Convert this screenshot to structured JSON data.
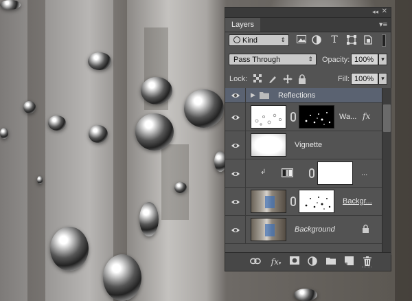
{
  "panel": {
    "tab_label": "Layers",
    "collapse_glyph": "◂◂",
    "close_glyph": "✕",
    "menu_glyph": "▾≡"
  },
  "filter": {
    "kind_label": "Kind",
    "kind_icon": "search-icon",
    "filter_icons": [
      "image-filter-icon",
      "adjustment-filter-icon",
      "type-filter-icon",
      "shape-filter-icon",
      "smart-object-filter-icon"
    ]
  },
  "blend": {
    "mode": "Pass Through",
    "opacity_label": "Opacity:",
    "opacity_value": "100%"
  },
  "lock": {
    "label": "Lock:",
    "fill_label": "Fill:",
    "fill_value": "100%",
    "icons": [
      "lock-transparent-icon",
      "lock-image-icon",
      "lock-position-icon",
      "lock-all-icon"
    ]
  },
  "layers": [
    {
      "name": "Reflections",
      "type": "group",
      "selected": true
    },
    {
      "name": "Wa...",
      "type": "smart-masked",
      "has_fx": true,
      "fx_label": "fx"
    },
    {
      "name": "Vignette",
      "type": "fill"
    },
    {
      "name": "...",
      "type": "adjustment-clipped"
    },
    {
      "name": "Backgr...",
      "type": "photo-masked"
    },
    {
      "name": "Background",
      "type": "background",
      "locked": true
    }
  ],
  "bottom_icons": [
    "link-layers-icon",
    "fx-icon",
    "add-mask-icon",
    "new-adjustment-icon",
    "new-group-icon",
    "new-layer-icon",
    "delete-layer-icon"
  ],
  "fx_symbol": "fx",
  "colors": {
    "panel_bg": "#535353",
    "selected_row": "#5a6271",
    "field_bg": "#c9c9c9"
  }
}
